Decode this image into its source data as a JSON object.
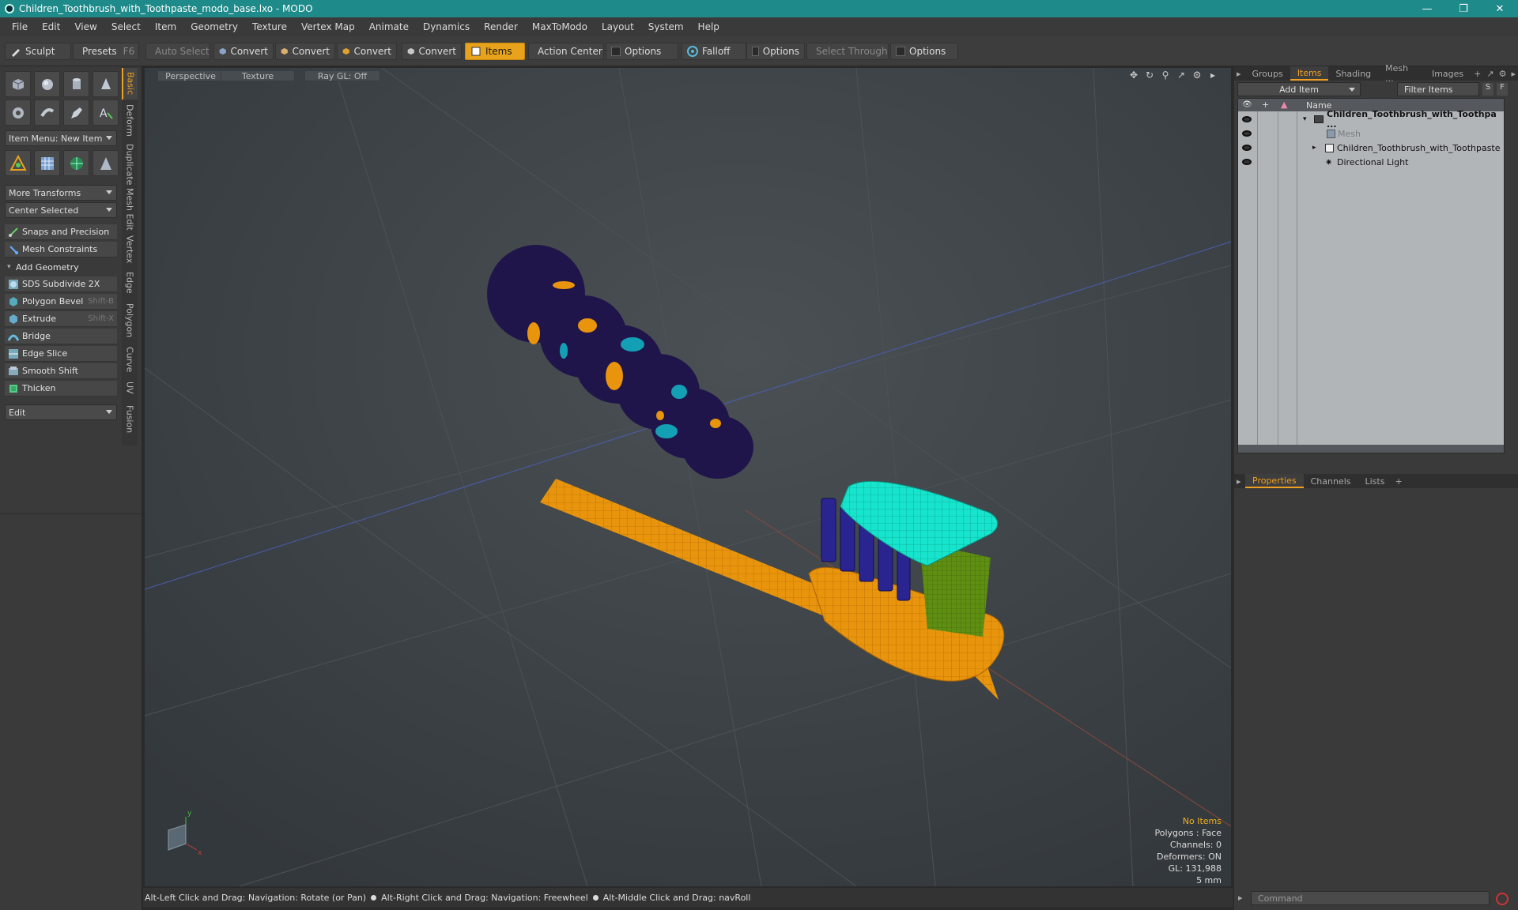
{
  "window": {
    "title": "Children_Toothbrush_with_Toothpaste_modo_base.lxo - MODO"
  },
  "menu": [
    "File",
    "Edit",
    "View",
    "Select",
    "Item",
    "Geometry",
    "Texture",
    "Vertex Map",
    "Animate",
    "Dynamics",
    "Render",
    "MaxToModo",
    "Layout",
    "System",
    "Help"
  ],
  "toolbar": {
    "sculpt": "Sculpt",
    "presets": "Presets",
    "presets_key": "F6",
    "auto_select": "Auto Select",
    "convert": "Convert",
    "items": "Items",
    "action_center": "Action Center",
    "options": "Options",
    "falloff": "Falloff",
    "select_through": "Select Through"
  },
  "left": {
    "item_menu": "Item Menu: New Item",
    "more_transforms": "More Transforms",
    "center_selected": "Center Selected",
    "snaps": "Snaps and Precision",
    "mesh_constraints": "Mesh Constraints",
    "add_geometry": "Add Geometry",
    "tools": [
      {
        "label": "SDS Subdivide 2X",
        "key": ""
      },
      {
        "label": "Polygon Bevel",
        "key": "Shift-B"
      },
      {
        "label": "Extrude",
        "key": "Shift-X"
      },
      {
        "label": "Bridge",
        "key": ""
      },
      {
        "label": "Edge Slice",
        "key": ""
      },
      {
        "label": "Smooth Shift",
        "key": ""
      },
      {
        "label": "Thicken",
        "key": ""
      }
    ],
    "edit": "Edit",
    "vtabs": [
      "Basic",
      "Deform",
      "Duplicate",
      "Mesh Edit",
      "Vertex",
      "Edge",
      "Polygon",
      "Curve",
      "UV",
      "Fusion"
    ]
  },
  "viewport": {
    "perspective": "Perspective",
    "texture": "Texture",
    "raygl": "Ray GL: Off",
    "info": {
      "no_items": "No Items",
      "polygons": "Polygons : Face",
      "channels": "Channels: 0",
      "deformers": "Deformers: ON",
      "gl": "GL: 131,988",
      "unit": "5 mm"
    }
  },
  "status": {
    "hint1": "Alt-Left Click and Drag: Navigation: Rotate (or Pan)",
    "hint2": "Alt-Right Click and Drag: Navigation: Freewheel",
    "hint3": "Alt-Middle Click and Drag: navRoll"
  },
  "right": {
    "tabs": [
      "Groups",
      "Items",
      "Shading",
      "Mesh ...",
      "Images"
    ],
    "add_item": "Add Item",
    "filter_items": "Filter Items",
    "s": "S",
    "f": "F",
    "col_name": "Name",
    "items": [
      "Children_Toothbrush_with_Toothpa ...",
      "Mesh",
      "Children_Toothbrush_with_Toothpaste",
      "Directional Light"
    ],
    "lower_tabs": [
      "Properties",
      "Channels",
      "Lists"
    ],
    "command": "Command"
  },
  "colors": {
    "accent": "#e8a21b",
    "titlebar": "#1e8a8a",
    "handle": "#e8940c",
    "bristle_blue": "#2a2490",
    "bristle_green": "#5a8c10",
    "paste": "#18e0c8",
    "grip": "#20154a"
  }
}
